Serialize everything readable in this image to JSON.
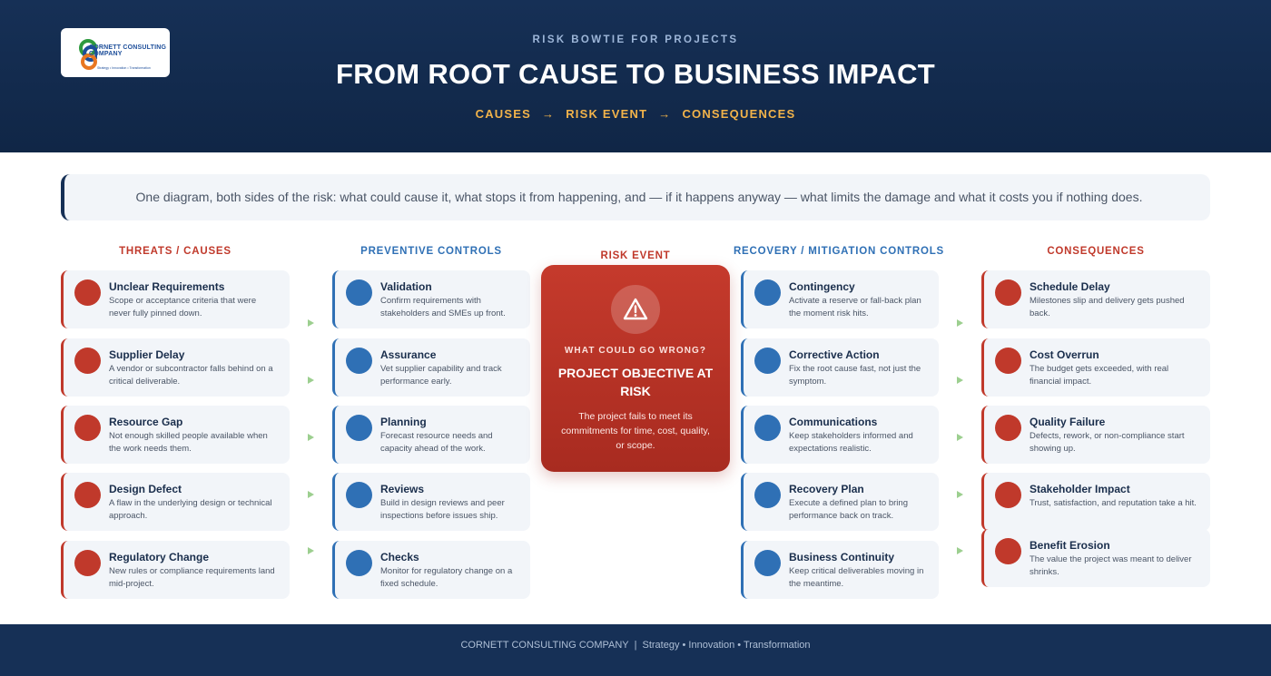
{
  "header": {
    "eyebrow": "RISK BOWTIE FOR PROJECTS",
    "title": "FROM ROOT CAUSE TO BUSINESS IMPACT",
    "flow": [
      "CAUSES",
      "RISK EVENT",
      "CONSEQUENCES"
    ],
    "flow_arrow": "→",
    "logo": {
      "name": "CORNETT CONSULTING COMPANY",
      "tagline": "Strategy • Innovation • Transformation"
    }
  },
  "intro": "One diagram, both sides of the risk: what could cause it, what stops it from happening, and — if it happens anyway — what limits the damage and what it costs you if nothing does.",
  "columns": {
    "threats": {
      "title": "THREATS / CAUSES",
      "items": [
        {
          "title": "Unclear Requirements",
          "desc": "Scope or acceptance criteria that were never fully pinned down."
        },
        {
          "title": "Supplier Delay",
          "desc": "A vendor or subcontractor falls behind on a critical deliverable."
        },
        {
          "title": "Resource Gap",
          "desc": "Not enough skilled people available when the work needs them."
        },
        {
          "title": "Design Defect",
          "desc": "A flaw in the underlying design or technical approach."
        },
        {
          "title": "Regulatory Change",
          "desc": "New rules or compliance requirements land mid-project."
        }
      ]
    },
    "preventive": {
      "title": "PREVENTIVE CONTROLS",
      "items": [
        {
          "title": "Validation",
          "desc": "Confirm requirements with stakeholders and SMEs up front."
        },
        {
          "title": "Assurance",
          "desc": "Vet supplier capability and track performance early."
        },
        {
          "title": "Planning",
          "desc": "Forecast resource needs and capacity ahead of the work."
        },
        {
          "title": "Reviews",
          "desc": "Build in design reviews and peer inspections before issues ship."
        },
        {
          "title": "Checks",
          "desc": "Monitor for regulatory change on a fixed schedule."
        }
      ]
    },
    "risk_event": {
      "title": "RISK EVENT",
      "question": "WHAT COULD GO WRONG?",
      "headline": "PROJECT OBJECTIVE AT RISK",
      "desc": "The project fails to meet its commitments for time, cost, quality, or scope."
    },
    "recovery": {
      "title": "RECOVERY / MITIGATION CONTROLS",
      "items": [
        {
          "title": "Contingency",
          "desc": "Activate a reserve or fall-back plan the moment risk hits."
        },
        {
          "title": "Corrective Action",
          "desc": "Fix the root cause fast, not just the symptom."
        },
        {
          "title": "Communications",
          "desc": "Keep stakeholders informed and expectations realistic."
        },
        {
          "title": "Recovery Plan",
          "desc": "Execute a defined plan to bring performance back on track."
        },
        {
          "title": "Business Continuity",
          "desc": "Keep critical deliverables moving in the meantime."
        }
      ]
    },
    "consequences": {
      "title": "CONSEQUENCES",
      "items": [
        {
          "title": "Schedule Delay",
          "desc": "Milestones slip and delivery gets pushed back."
        },
        {
          "title": "Cost Overrun",
          "desc": "The budget gets exceeded, with real financial impact."
        },
        {
          "title": "Quality Failure",
          "desc": "Defects, rework, or non-compliance start showing up."
        },
        {
          "title": "Stakeholder Impact",
          "desc": "Trust, satisfaction, and reputation take a hit."
        },
        {
          "title": "Benefit Erosion",
          "desc": "The value the project was meant to deliver shrinks."
        }
      ]
    }
  },
  "footer": {
    "company": "CORNETT CONSULTING COMPANY",
    "separator": "|",
    "tagline": "Strategy • Innovation • Transformation"
  },
  "colors": {
    "navy": "#163056",
    "threat_red": "#c0392b",
    "control_blue": "#2f70b5",
    "flow_orange": "#f2b34a",
    "connector_green": "#9ccf8f",
    "card_bg": "#f2f5f9"
  },
  "icons": {
    "risk_event": "warning-triangle-icon",
    "connector": "chevron-right-icon"
  }
}
